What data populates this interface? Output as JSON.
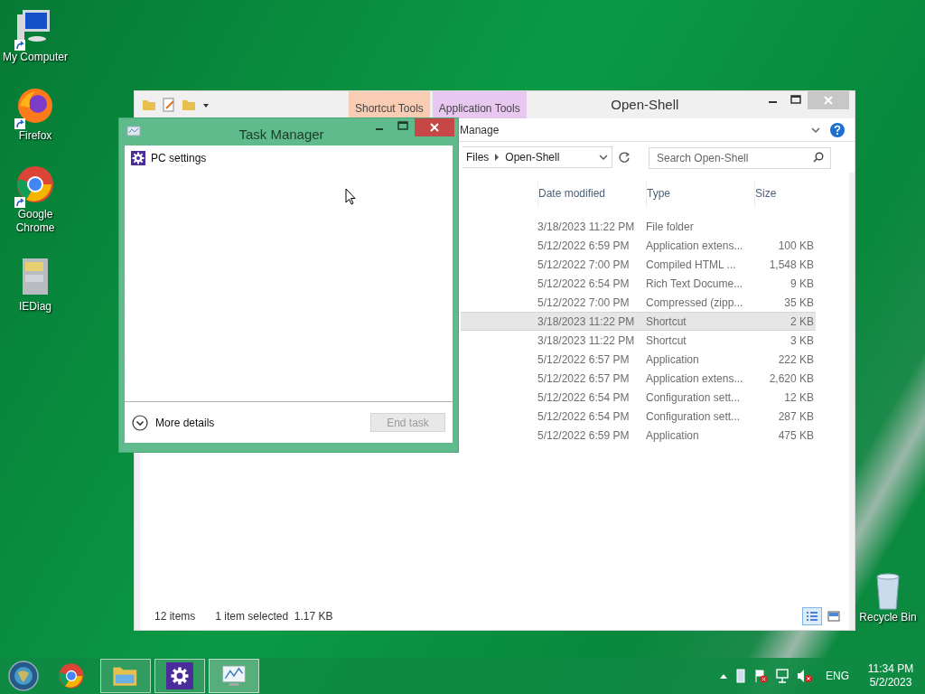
{
  "desktop_icons": [
    {
      "label": "My Computer",
      "kind": "computer",
      "shortcut": true
    },
    {
      "label": "Firefox",
      "kind": "firefox",
      "shortcut": true
    },
    {
      "label": "Google Chrome",
      "kind": "chrome",
      "shortcut": true
    },
    {
      "label": "IEDiag",
      "kind": "cabinet",
      "shortcut": false
    }
  ],
  "recycle_bin": {
    "label": "Recycle Bin"
  },
  "explorer": {
    "title": "Open-Shell",
    "context_tabs": [
      {
        "label": "Shortcut Tools",
        "color": "#f9cdb4"
      },
      {
        "label": "Application Tools",
        "color": "#e8c8f0"
      }
    ],
    "ribbon_tab": "Manage",
    "address": [
      "Files",
      "Open-Shell"
    ],
    "search": {
      "placeholder": "Search Open-Shell"
    },
    "columns": [
      "Date modified",
      "Type",
      "Size"
    ],
    "rows": [
      {
        "date": "3/18/2023 11:22 PM",
        "type": "File folder",
        "selected": false
      },
      {
        "date": "5/12/2022 6:59 PM",
        "type": "Application extens...",
        "size": "100 KB",
        "selected": false
      },
      {
        "date": "5/12/2022 7:00 PM",
        "type": "Compiled HTML ...",
        "size": "1,548 KB",
        "selected": false
      },
      {
        "date": "5/12/2022 6:54 PM",
        "type": "Rich Text Docume...",
        "size": "9 KB",
        "selected": false
      },
      {
        "date": "5/12/2022 7:00 PM",
        "type": "Compressed (zipp...",
        "size": "35 KB",
        "selected": false
      },
      {
        "date": "3/18/2023 11:22 PM",
        "type": "Shortcut",
        "size": "2 KB",
        "selected": true
      },
      {
        "date": "3/18/2023 11:22 PM",
        "type": "Shortcut",
        "size": "3 KB",
        "selected": false
      },
      {
        "date": "5/12/2022 6:57 PM",
        "type": "Application",
        "size": "222 KB",
        "selected": false
      },
      {
        "date": "5/12/2022 6:57 PM",
        "type": "Application extens...",
        "size": "2,620 KB",
        "selected": false
      },
      {
        "date": "5/12/2022 6:54 PM",
        "type": "Configuration sett...",
        "size": "12 KB",
        "selected": false
      },
      {
        "date": "5/12/2022 6:54 PM",
        "type": "Configuration sett...",
        "size": "287 KB",
        "selected": false
      },
      {
        "date": "5/12/2022 6:59 PM",
        "type": "Application",
        "size": "475 KB",
        "selected": false
      }
    ],
    "status": {
      "count": "12 items",
      "selection": "1 item selected  1.17 KB"
    },
    "views": [
      {
        "kind": "details",
        "selected": true
      },
      {
        "kind": "tiles",
        "selected": false
      }
    ]
  },
  "task_manager": {
    "title": "Task Manager",
    "apps": [
      {
        "label": "PC settings"
      }
    ],
    "more_details": "More details",
    "end_task": {
      "label": "End task",
      "disabled": true
    }
  },
  "taskbar": {
    "items": [
      {
        "kind": "chrome",
        "running": false,
        "selected": false
      },
      {
        "kind": "explorer",
        "running": true,
        "selected": false
      },
      {
        "kind": "settings",
        "running": true,
        "selected": false
      },
      {
        "kind": "taskmanager",
        "running": true,
        "selected": true
      }
    ],
    "language": "ENG",
    "time": "11:34 PM",
    "date": "5/2/2023"
  }
}
